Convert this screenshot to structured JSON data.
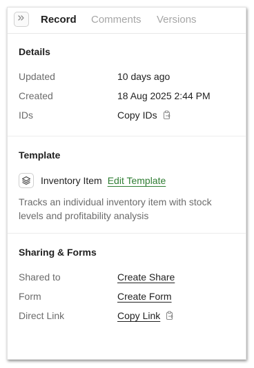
{
  "tabs": [
    {
      "label": "Record",
      "active": true
    },
    {
      "label": "Comments",
      "active": false
    },
    {
      "label": "Versions",
      "active": false
    }
  ],
  "icons": {
    "collapse": "chevrons-right-icon",
    "copy": "copy-icon",
    "template": "layers-icon"
  },
  "details": {
    "title": "Details",
    "updated_label": "Updated",
    "updated_value": "10 days ago",
    "created_label": "Created",
    "created_value": "18 Aug 2025 2:44 PM",
    "ids_label": "IDs",
    "ids_value": "Copy IDs"
  },
  "template": {
    "title": "Template",
    "name": "Inventory Item",
    "edit_label": "Edit Template",
    "description": "Tracks an individual inventory item with stock levels and profitability analysis"
  },
  "sharing": {
    "title": "Sharing & Forms",
    "shared_label": "Shared to",
    "shared_value": "Create Share",
    "form_label": "Form",
    "form_value": "Create Form",
    "link_label": "Direct Link",
    "link_value": "Copy Link"
  },
  "colors": {
    "accent_link": "#2e7d32",
    "muted_text": "#6b6b6b",
    "inactive_tab": "#a6a6a6"
  }
}
